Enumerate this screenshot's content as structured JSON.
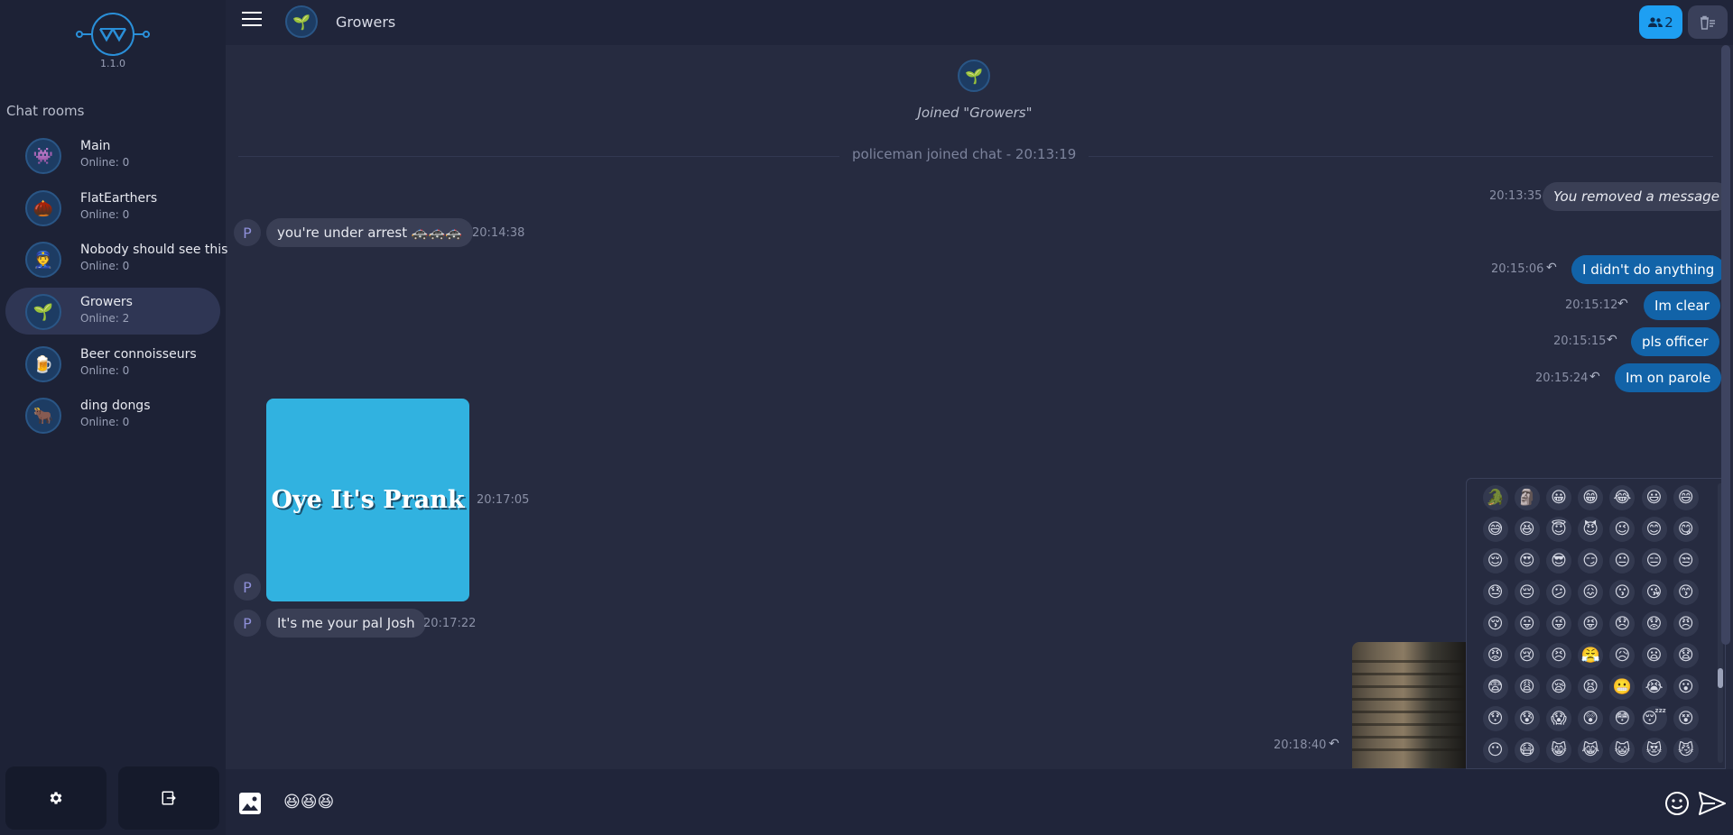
{
  "app": {
    "version": "1.1.0"
  },
  "sidebar": {
    "heading": "Chat rooms",
    "rooms": [
      {
        "name": "Main",
        "online": "Online: 0",
        "icon": "👾"
      },
      {
        "name": "FlatEarthers",
        "online": "Online: 0",
        "icon": "🌰"
      },
      {
        "name": "Nobody should see this",
        "online": "Online: 0",
        "icon": "👮"
      },
      {
        "name": "Growers",
        "online": "Online: 2",
        "icon": "🌱"
      },
      {
        "name": "Beer connoisseurs",
        "online": "Online: 0",
        "icon": "🍺"
      },
      {
        "name": "ding dongs",
        "online": "Online: 0",
        "icon": "🐂"
      }
    ],
    "buttons": {
      "settings_icon": "gear-icon",
      "logout_icon": "logout-icon"
    }
  },
  "header": {
    "title": "Growers",
    "room_icon": "🌱",
    "users_count": "2",
    "accent": "#1e9ff2"
  },
  "chat": {
    "joined_icon": "🌱",
    "joined_text": "Joined \"Growers\"",
    "system_message": "policeman joined chat - 20:13:19",
    "messages": [
      {
        "time": "20:13:35",
        "text": "You removed a message"
      },
      {
        "avatar": "P",
        "text": "you're under arrest 🚓🚓🚓",
        "time": "20:14:38"
      },
      {
        "time": "20:15:06",
        "text": "I didn't do anything"
      },
      {
        "time": "20:15:12",
        "text": "Im clear"
      },
      {
        "time": "20:15:15",
        "text": "pls officer"
      },
      {
        "time": "20:15:24",
        "text": "Im on parole"
      },
      {
        "avatar": "P",
        "image_text": "Oye It's Prank",
        "time": "20:17:05"
      },
      {
        "avatar": "P",
        "text": "It's me your pal Josh",
        "time": "20:17:22"
      },
      {
        "time": "20:18:40"
      }
    ],
    "own_bubble_color": "#1263a8",
    "other_bubble_color": "#3a3f55"
  },
  "emoji_picker": {
    "emojis": [
      "🐊",
      "🗿",
      "😀",
      "😁",
      "😂",
      "😃",
      "😄",
      "😅",
      "😆",
      "😇",
      "😈",
      "😉",
      "😊",
      "😋",
      "😌",
      "😍",
      "😎",
      "😏",
      "😐",
      "😑",
      "😒",
      "😓",
      "😔",
      "😕",
      "😖",
      "😗",
      "😘",
      "😙",
      "😚",
      "😛",
      "😜",
      "😝",
      "😞",
      "😟",
      "😠",
      "😡",
      "😢",
      "😣",
      "😤",
      "😥",
      "😦",
      "😧",
      "😨",
      "😩",
      "😪",
      "😫",
      "😬",
      "😭",
      "😮",
      "😯",
      "😰",
      "😱",
      "😲",
      "😳",
      "😴",
      "😵",
      "😶",
      "😷",
      "😸",
      "😹",
      "😺",
      "😻",
      "😼"
    ]
  },
  "composer": {
    "value": "😆😆😆",
    "image_icon": "image-icon",
    "emoji_icon": "smiley-icon",
    "send_icon": "send-icon"
  }
}
